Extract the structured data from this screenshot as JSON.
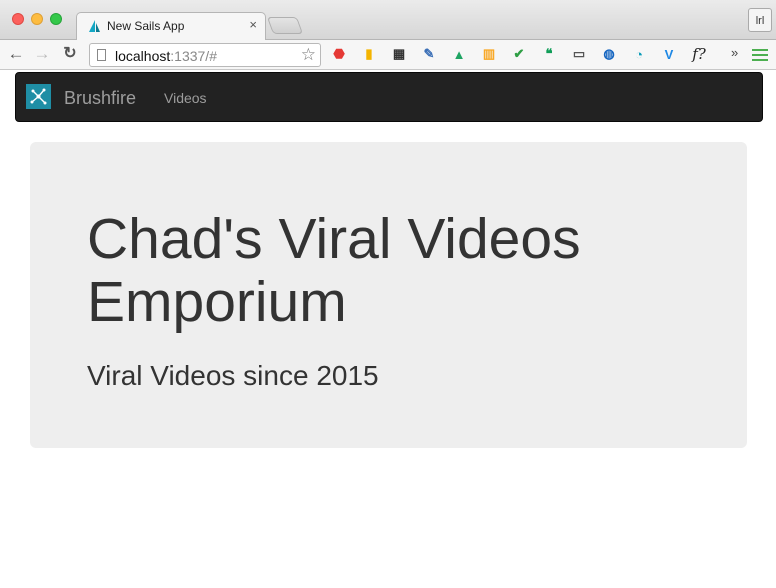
{
  "browser": {
    "tab_title": "New Sails App",
    "tab_close": "×",
    "profile_label": "lrl",
    "url_host": "localhost",
    "url_rest": ":1337/#",
    "overflow": "»",
    "extensions": [
      {
        "name": "adblock-icon",
        "glyph": "⬣",
        "color": "#e53935"
      },
      {
        "name": "mobile-icon",
        "glyph": "▮",
        "color": "#f4b400"
      },
      {
        "name": "qr-icon",
        "glyph": "▦",
        "color": "#333333"
      },
      {
        "name": "eyedropper-icon",
        "glyph": "✎",
        "color": "#3b6fb6"
      },
      {
        "name": "google-drive-icon",
        "glyph": "▲",
        "color": "#1fa463"
      },
      {
        "name": "analytics-icon",
        "glyph": "▥",
        "color": "#f9a825"
      },
      {
        "name": "checkmark-icon",
        "glyph": "✔",
        "color": "#2e9e44"
      },
      {
        "name": "hangouts-icon",
        "glyph": "❝",
        "color": "#0f9d58"
      },
      {
        "name": "cast-icon",
        "glyph": "▭",
        "color": "#555555"
      },
      {
        "name": "globe-icon",
        "glyph": "◍",
        "color": "#1565c0"
      },
      {
        "name": "wave-icon",
        "glyph": "◔",
        "color": "#0a9bb8"
      },
      {
        "name": "vimium-icon",
        "glyph": "V",
        "color": "#1e88e5"
      },
      {
        "name": "formula-icon",
        "glyph": "f?",
        "color": "#222222"
      }
    ],
    "colors": {
      "menu_accent": "#4caf50"
    }
  },
  "app": {
    "brand": "Brushfire",
    "nav_links": [
      "Videos"
    ],
    "jumbotron": {
      "title": "Chad's Viral Videos Emporium",
      "subtitle": "Viral Videos since 2015"
    },
    "colors": {
      "navbar_bg": "#222222",
      "brand_logo": "#1f8ea5",
      "jumbotron_bg": "#eeeeee"
    }
  }
}
